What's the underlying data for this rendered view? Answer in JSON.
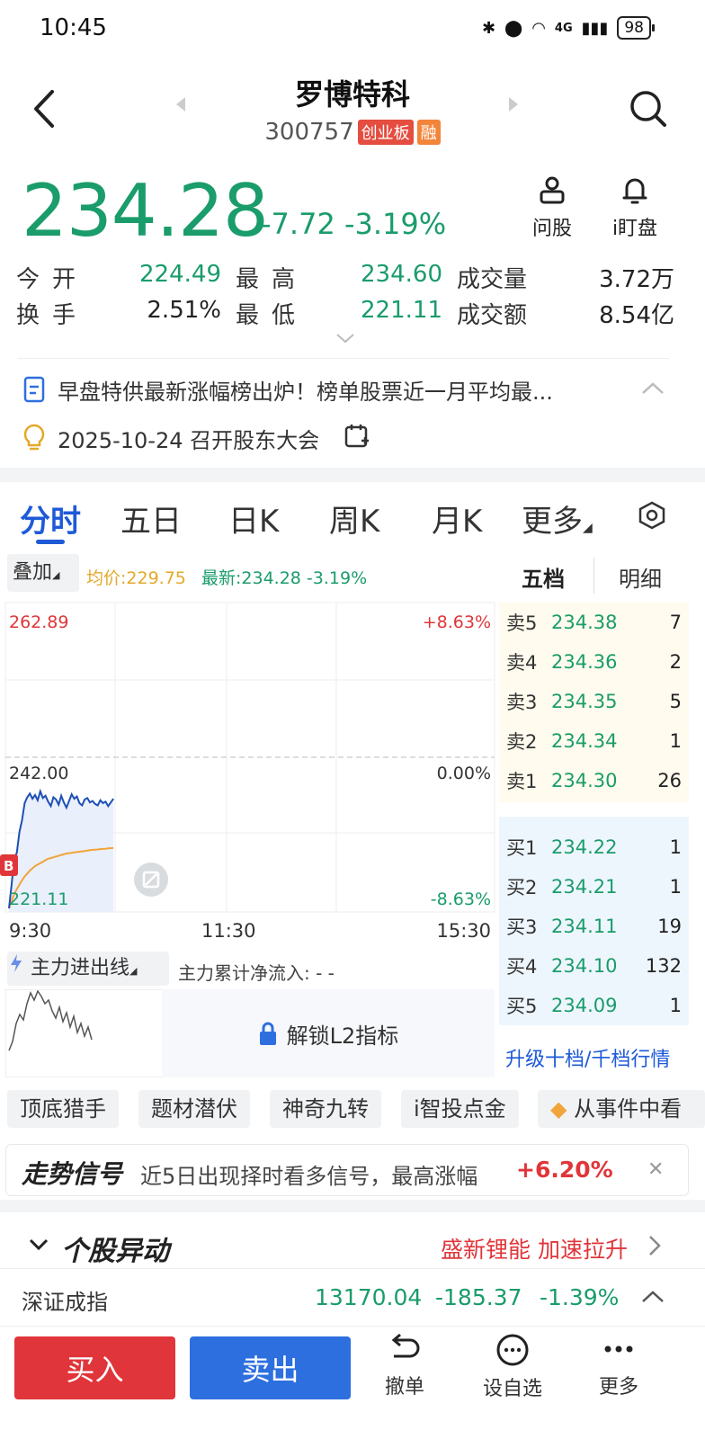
{
  "status": {
    "time": "10:45",
    "network": "4G",
    "battery": "98"
  },
  "header": {
    "name": "罗博特科",
    "code": "300757",
    "board_badge": "创业板",
    "margin_badge": "融"
  },
  "quote": {
    "price": "234.28",
    "change": "-7.72",
    "change_pct": "-3.19%",
    "ask_label": "问股",
    "watch_label": "i盯盘",
    "stats": {
      "open_label": "今开",
      "open": "224.49",
      "high_label": "最高",
      "high": "234.60",
      "vol_label": "成交量",
      "vol": "3.72万",
      "turnover_label": "换手",
      "turnover": "2.51%",
      "low_label": "最低",
      "low": "221.11",
      "amount_label": "成交额",
      "amount": "8.54亿"
    }
  },
  "news": {
    "headline": "早盘特供最新涨幅榜出炉！榜单股票近一月平均最...",
    "meeting": "2025-10-24 召开股东大会"
  },
  "tabs": [
    "分时",
    "五日",
    "日K",
    "周K",
    "月K",
    "更多"
  ],
  "chart_header": {
    "overlay": "叠加",
    "avg": "均价:229.75",
    "latest": "最新:234.28 -3.19%",
    "tab_five": "五档",
    "tab_detail": "明细"
  },
  "chart_data": {
    "type": "line",
    "title": "",
    "y_left": [
      "262.89",
      "242.00",
      "221.11"
    ],
    "y_right": [
      "+8.63%",
      "0.00%",
      "-8.63%"
    ],
    "x_labels": [
      "9:30",
      "11:30",
      "15:30"
    ],
    "ylim": [
      221.11,
      262.89
    ],
    "prev_close": 242.0,
    "marker": "B",
    "series": [
      {
        "color": "#1e4fb5",
        "values": [
          221.6,
          224.8,
          228.3,
          229.1,
          231.9,
          233.5,
          235.8,
          236.6,
          237.1,
          236.4,
          236.9,
          236.2,
          237.4,
          236.5,
          236.8,
          236.0,
          235.4,
          236.6,
          236.3,
          235.6,
          236.8,
          235.9,
          235.2,
          236.1,
          237.0,
          236.4,
          236.7,
          235.8,
          235.5,
          236.3,
          236.5,
          235.9,
          236.1,
          235.7,
          235.5,
          236.2,
          235.8,
          236.0,
          235.4,
          235.9,
          236.4
        ]
      },
      {
        "color": "#f1a43a",
        "values": [
          221.6,
          222.6,
          223.5,
          224.2,
          224.8,
          225.4,
          225.9,
          226.3,
          226.7,
          227.0,
          227.3,
          227.5,
          227.7,
          227.9,
          228.1,
          228.3,
          228.4,
          228.5,
          228.6,
          228.7,
          228.8,
          228.9,
          229.0,
          229.05,
          229.1,
          229.15,
          229.2,
          229.25,
          229.3,
          229.35,
          229.4,
          229.45,
          229.5,
          229.52,
          229.55,
          229.6,
          229.62,
          229.65,
          229.7,
          229.72,
          229.75
        ]
      }
    ]
  },
  "orderbook": {
    "sell": [
      {
        "label": "卖5",
        "price": "234.38",
        "vol": "7"
      },
      {
        "label": "卖4",
        "price": "234.36",
        "vol": "2"
      },
      {
        "label": "卖3",
        "price": "234.35",
        "vol": "5"
      },
      {
        "label": "卖2",
        "price": "234.34",
        "vol": "1"
      },
      {
        "label": "卖1",
        "price": "234.30",
        "vol": "26"
      }
    ],
    "buy": [
      {
        "label": "买1",
        "price": "234.22",
        "vol": "1"
      },
      {
        "label": "买2",
        "price": "234.21",
        "vol": "1"
      },
      {
        "label": "买3",
        "price": "234.11",
        "vol": "19"
      },
      {
        "label": "买4",
        "price": "234.10",
        "vol": "132"
      },
      {
        "label": "买5",
        "price": "234.09",
        "vol": "1"
      }
    ],
    "upgrade": "升级十档/千档行情"
  },
  "main_force": {
    "line_label": "主力进出线",
    "net_inflow": "主力累计净流入: - -",
    "unlock": "解锁L2指标"
  },
  "chips": [
    "顶底猎手",
    "题材潜伏",
    "神奇九转",
    "i智投点金",
    "从事件中看"
  ],
  "signal": {
    "title": "走势信号",
    "text": "近5日出现择时看多信号，最高涨幅",
    "pct": "+6.20%"
  },
  "abnormal": {
    "title": "个股异动",
    "event": "盛新锂能 加速拉升"
  },
  "index": {
    "name": "深证成指",
    "value": "13170.04",
    "change": "-185.37",
    "pct": "-1.39%"
  },
  "bottom": {
    "buy": "买入",
    "sell": "卖出",
    "cancel": "撤单",
    "add_watch": "设自选",
    "more": "更多"
  }
}
